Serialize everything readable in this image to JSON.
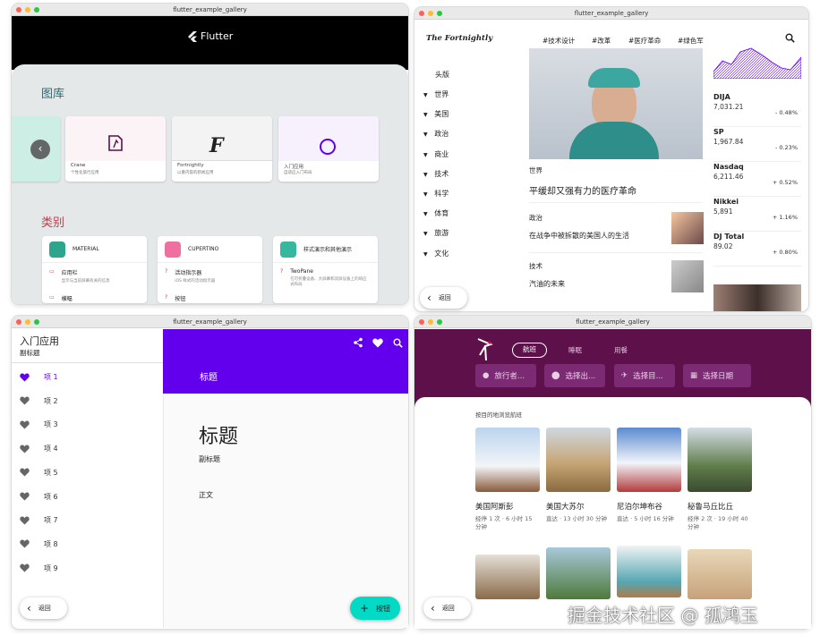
{
  "w1": {
    "title": "flutter_example_gallery",
    "logo_text": "Flutter",
    "gallery_title": "图库",
    "categories_title": "类别",
    "cards": [
      {
        "name": "Crane",
        "desc": "个性化旅行应用"
      },
      {
        "name": "Fortnightly",
        "desc": "以重内容的新闻应用"
      },
      {
        "name": "入门应用",
        "desc": "自适应入门布局"
      }
    ],
    "cats": [
      {
        "name": "MATERIAL",
        "item": "应用栏",
        "item_desc": "显示与当前屏幕有关的信息",
        "item2": "横幅"
      },
      {
        "name": "CUPERTINO",
        "item": "活动指示器",
        "item_desc": "iOS 样式的活动指示器",
        "item2": "按钮"
      },
      {
        "name": "样式演示和其他演示",
        "item": "TwoPane",
        "item_desc": "在可折叠设备、大屏幕和双屏设备上的响应式布局"
      }
    ],
    "colors": {
      "gallery": "#1d6e79",
      "categories": "#b5434c"
    }
  },
  "w2": {
    "title": "flutter_example_gallery",
    "masthead": "The Fortnightly",
    "tags": [
      "#技术设计",
      "#改革",
      "#医疗革命",
      "#绿色军"
    ],
    "nav": [
      "头版",
      "世界",
      "美国",
      "政治",
      "商业",
      "技术",
      "科学",
      "体育",
      "旅游",
      "文化"
    ],
    "lead": {
      "section": "世界",
      "headline": "平缓却又强有力的医疗革命"
    },
    "stories": [
      {
        "section": "政治",
        "headline": "在战争中被拆散的美国人的生活"
      },
      {
        "section": "技术",
        "headline": "汽油的未来"
      }
    ],
    "stocks": [
      {
        "name": "DIJA",
        "value": "7,031.21",
        "change": "-  0.48%"
      },
      {
        "name": "SP",
        "value": "1,967.84",
        "change": "-  0.23%"
      },
      {
        "name": "Nasdaq",
        "value": "6,211.46",
        "change": "+  0.52%"
      },
      {
        "name": "Nikkei",
        "value": "5,891",
        "change": "+  1.16%"
      },
      {
        "name": "DJ Total",
        "value": "89.02",
        "change": "+  0.80%"
      }
    ],
    "back": "返回"
  },
  "w3": {
    "title": "flutter_example_gallery",
    "app_title": "入门应用",
    "app_subtitle": "副标题",
    "items": [
      "项 1",
      "项 2",
      "项 3",
      "项 4",
      "项 5",
      "项 6",
      "项 7",
      "项 8",
      "项 9"
    ],
    "header_label": "标题",
    "detail_title": "标题",
    "detail_subtitle": "副标题",
    "detail_body": "正文",
    "back": "返回",
    "fab": "按钮",
    "accent": "#6200ee",
    "fab_color": "#03dac6"
  },
  "w4": {
    "title": "flutter_example_gallery",
    "tabs": [
      "航班",
      "睡眠",
      "用餐"
    ],
    "chips": [
      "旅行者...",
      "选择出...",
      "选择目...",
      "选择日期"
    ],
    "explore": "按目的地浏览航班",
    "dests": [
      {
        "name": "美国阿斯彭",
        "info": "经停 1 次 · 6 小时 15 分钟"
      },
      {
        "name": "美国大苏尔",
        "info": "直达 · 13 小时 30 分钟"
      },
      {
        "name": "尼泊尔坤布谷",
        "info": "直达 · 5 小时 16 分钟"
      },
      {
        "name": "秘鲁马丘比丘",
        "info": "经停 2 次 · 19 小时 40 分钟"
      }
    ],
    "back": "返回",
    "brand": "#5d1049"
  },
  "watermark": "掘金技术社区 @ 孤鸿玉"
}
